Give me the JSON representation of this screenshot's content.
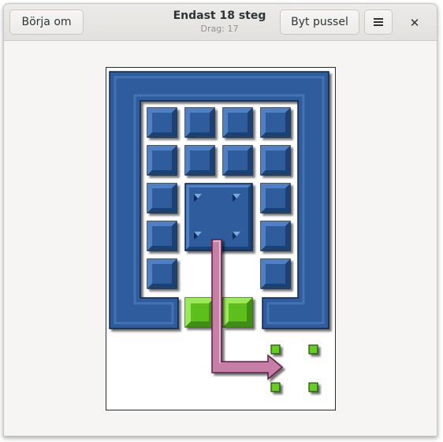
{
  "header": {
    "restart_label": "Börja om",
    "title": "Endast 18 steg",
    "subtitle": "Drag: 17",
    "change_puzzle_label": "Byt pussel",
    "menu_icon": "hamburger-menu-icon",
    "close_icon": "close-icon"
  },
  "colors": {
    "block_blue": "#2d5c9c",
    "goal_green": "#66cc22",
    "arrow_pink": "#c77fa8"
  },
  "board": {
    "grid_columns": 4,
    "grid_rows": 7,
    "frame": "U-shaped blue wall open at the bottom middle",
    "blocks": [
      {
        "type": "small",
        "col": 0,
        "row": 0
      },
      {
        "type": "small",
        "col": 1,
        "row": 0
      },
      {
        "type": "small",
        "col": 2,
        "row": 0
      },
      {
        "type": "small",
        "col": 3,
        "row": 0
      },
      {
        "type": "small",
        "col": 0,
        "row": 1
      },
      {
        "type": "small",
        "col": 1,
        "row": 1
      },
      {
        "type": "small",
        "col": 2,
        "row": 1
      },
      {
        "type": "small",
        "col": 3,
        "row": 1
      },
      {
        "type": "small",
        "col": 0,
        "row": 2
      },
      {
        "type": "small",
        "col": 3,
        "row": 2
      },
      {
        "type": "small",
        "col": 0,
        "row": 3
      },
      {
        "type": "small",
        "col": 3,
        "row": 3
      },
      {
        "type": "small",
        "col": 0,
        "row": 4
      },
      {
        "type": "small",
        "col": 3,
        "row": 4
      },
      {
        "type": "large",
        "col": 1,
        "row": 2,
        "width": 2,
        "height": 2
      }
    ],
    "goal_blocks": [
      {
        "col": 1,
        "row": 5
      },
      {
        "col": 2,
        "row": 5
      }
    ],
    "hint_arrow": "move large block down and out to the right",
    "target_marker": "four green corner dots"
  }
}
